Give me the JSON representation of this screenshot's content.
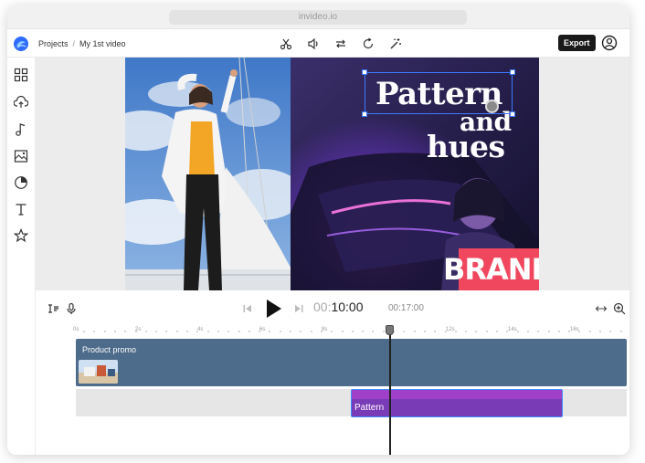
{
  "browser": {
    "url": "invideo.io"
  },
  "header": {
    "breadcrumb_projects": "Projects",
    "breadcrumb_separator": "/",
    "project_name": "My 1st video",
    "export_label": "Export",
    "tools": [
      "scissors-icon",
      "volume-icon",
      "swap-icon",
      "rotate-icon",
      "magic-wand-icon"
    ]
  },
  "sidebar": {
    "items": [
      "templates-icon",
      "upload-icon",
      "music-icon",
      "media-icon",
      "sticker-icon",
      "text-icon",
      "star-icon"
    ]
  },
  "canvas": {
    "overlay_line1": "Pattern",
    "overlay_line2": "and",
    "overlay_line3": "hues",
    "brand_text": "BRAND"
  },
  "player": {
    "timecode_dim": "00:",
    "timecode_current": "10:00",
    "duration": "00:17:00"
  },
  "timeline": {
    "ticks": [
      "0s",
      "2s",
      "4s",
      "6s",
      "8s",
      "10s",
      "12s",
      "14s",
      "16s"
    ],
    "track1_label": "Product promo",
    "clip_label": "Pattern"
  },
  "colors": {
    "accent": "#3d7bff",
    "track1": "#4d6b8a",
    "clip": "#7a3bb7",
    "brand": "#f0475e"
  }
}
